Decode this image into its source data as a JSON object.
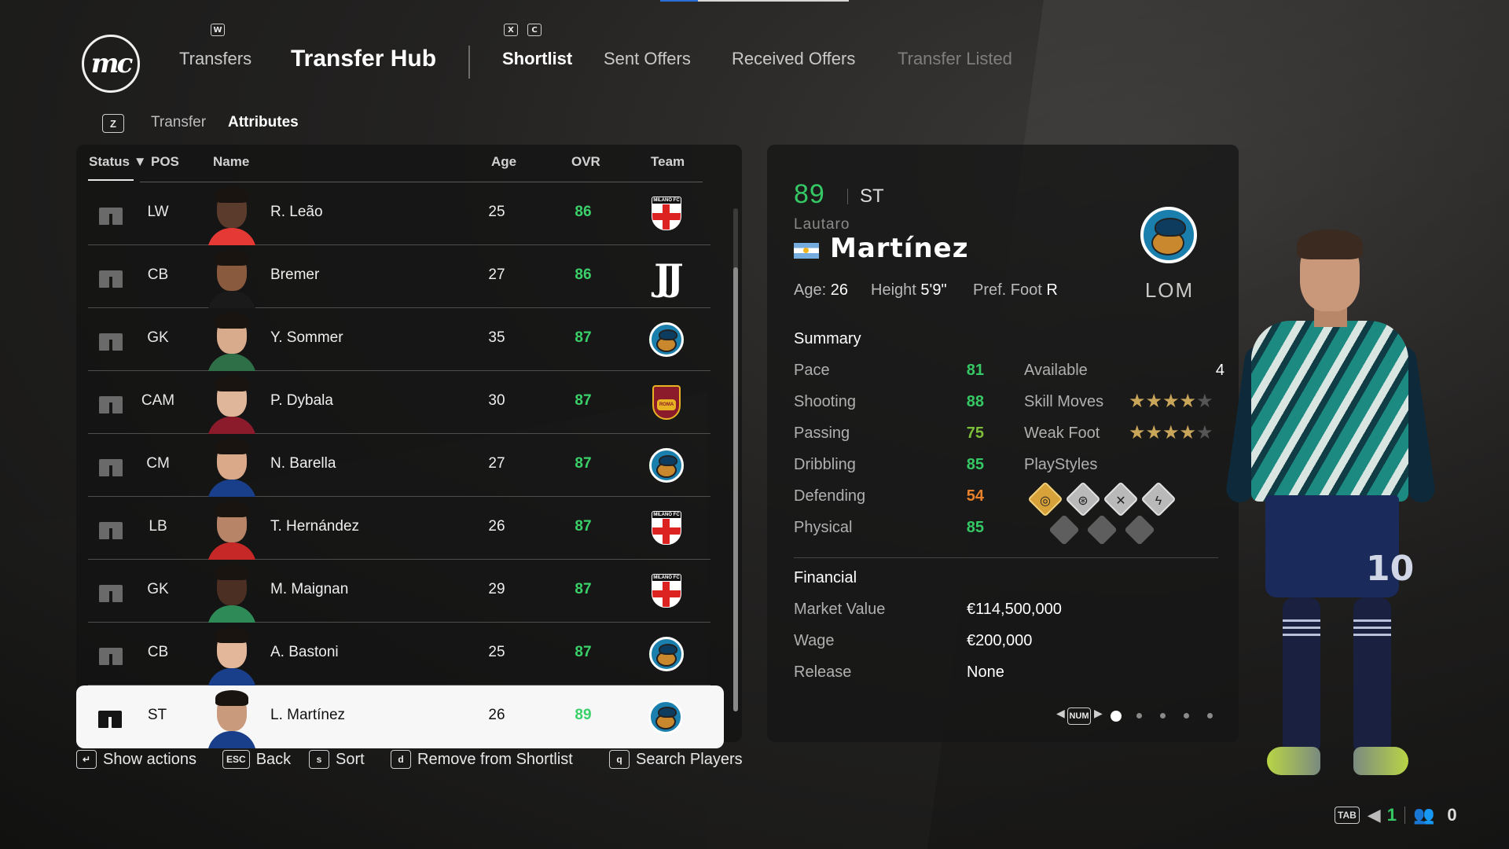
{
  "header": {
    "logo_text": "mc",
    "nav_key_left": "W",
    "nav_keys_right": [
      "X",
      "C"
    ],
    "transfers": "Transfers",
    "transfer_hub": "Transfer Hub",
    "tabs": [
      "Shortlist",
      "Sent Offers",
      "Received Offers",
      "Transfer Listed"
    ],
    "active_tab": "Shortlist"
  },
  "subnav": {
    "key": "Z",
    "tabs": [
      "Transfer",
      "Attributes"
    ],
    "active": "Attributes"
  },
  "table": {
    "columns": {
      "status": "Status",
      "pos": "POS",
      "name": "Name",
      "age": "Age",
      "ovr": "OVR",
      "team": "Team"
    },
    "rows": [
      {
        "pos": "LW",
        "name": "R. Leão",
        "age": "25",
        "ovr": "86",
        "team_icon": "milan-crest"
      },
      {
        "pos": "CB",
        "name": "Bremer",
        "age": "27",
        "ovr": "86",
        "team_icon": "juventus-crest"
      },
      {
        "pos": "GK",
        "name": "Y. Sommer",
        "age": "35",
        "ovr": "87",
        "team_icon": "lom-crest"
      },
      {
        "pos": "CAM",
        "name": "P. Dybala",
        "age": "30",
        "ovr": "87",
        "team_icon": "roma-crest"
      },
      {
        "pos": "CM",
        "name": "N. Barella",
        "age": "27",
        "ovr": "87",
        "team_icon": "lom-crest"
      },
      {
        "pos": "LB",
        "name": "T. Hernández",
        "age": "26",
        "ovr": "87",
        "team_icon": "milan-crest"
      },
      {
        "pos": "GK",
        "name": "M. Maignan",
        "age": "29",
        "ovr": "87",
        "team_icon": "milan-crest"
      },
      {
        "pos": "CB",
        "name": "A. Bastoni",
        "age": "25",
        "ovr": "87",
        "team_icon": "lom-crest"
      },
      {
        "pos": "ST",
        "name": "L. Martínez",
        "age": "26",
        "ovr": "89",
        "team_icon": "lom-crest",
        "selected": true
      }
    ]
  },
  "player": {
    "ovr": "89",
    "position": "ST",
    "first_name": "Lautaro",
    "last_name": "Martínez",
    "nationality_flag": "argentina-flag",
    "age_label": "Age:",
    "age": "26",
    "height_label": "Height",
    "height": "5'9\"",
    "foot_label": "Pref. Foot",
    "foot": "R",
    "club": "LOM",
    "kit_number": "10"
  },
  "summary": {
    "title": "Summary",
    "stats": [
      {
        "label": "Pace",
        "value": "81",
        "color": "#35c864"
      },
      {
        "label": "Shooting",
        "value": "88",
        "color": "#35c864"
      },
      {
        "label": "Passing",
        "value": "75",
        "color": "#7dbf3a"
      },
      {
        "label": "Dribbling",
        "value": "85",
        "color": "#35c864"
      },
      {
        "label": "Defending",
        "value": "54",
        "color": "#e8812a"
      },
      {
        "label": "Physical",
        "value": "85",
        "color": "#35c864"
      }
    ],
    "available_label": "Available",
    "available": "4",
    "skill_moves_label": "Skill Moves",
    "skill_moves": 4,
    "weak_foot_label": "Weak Foot",
    "weak_foot": 4,
    "star_max": 5,
    "playstyles_label": "PlayStyles",
    "playstyles": [
      "finesse-shot-plus-icon",
      "power-shot-icon",
      "acrobatic-icon",
      "quick-step-icon"
    ]
  },
  "financial": {
    "title": "Financial",
    "market_value_label": "Market Value",
    "market_value": "€114,500,000",
    "wage_label": "Wage",
    "wage": "€200,000",
    "release_label": "Release",
    "release": "None"
  },
  "pager": {
    "key": "NUM",
    "pages": 5,
    "current": 1
  },
  "actions": [
    {
      "key": "↵",
      "label": "Show actions"
    },
    {
      "key": "ESC",
      "label": "Back"
    },
    {
      "key": "s",
      "label": "Sort"
    },
    {
      "key": "d",
      "label": "Remove from Shortlist"
    },
    {
      "key": "q",
      "label": "Search Players"
    }
  ],
  "corner": {
    "tab_key": "TAB",
    "count_a": "1",
    "count_b": "0"
  }
}
